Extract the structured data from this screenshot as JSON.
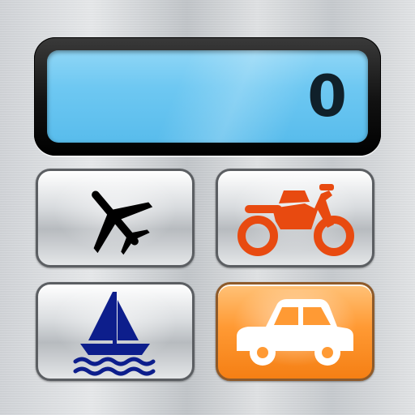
{
  "display": {
    "value": "0",
    "screen_color": "#6ec8f2"
  },
  "keys": [
    {
      "id": "plane",
      "icon": "airplane-icon",
      "color": "#000000",
      "background": "silver"
    },
    {
      "id": "motorcycle",
      "icon": "motorcycle-icon",
      "color": "#e84a10",
      "background": "silver"
    },
    {
      "id": "boat",
      "icon": "sailboat-icon",
      "color": "#0d1e8c",
      "background": "silver"
    },
    {
      "id": "car",
      "icon": "car-icon",
      "color": "#ffffff",
      "background": "#ff9a34"
    }
  ]
}
